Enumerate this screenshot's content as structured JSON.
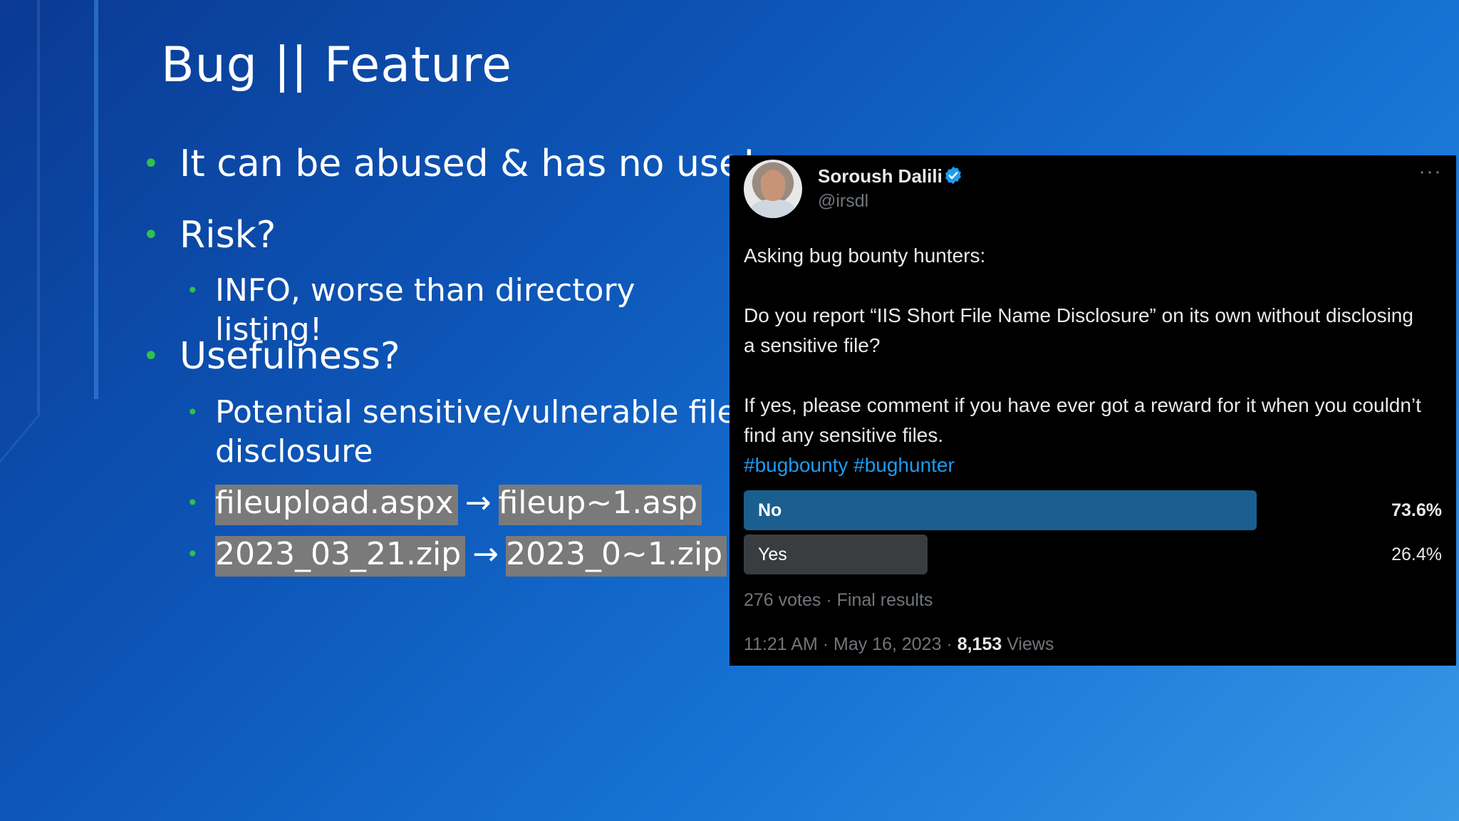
{
  "slide": {
    "title": "Bug || Feature",
    "bullets": [
      {
        "text": "It can be abused & has no use!"
      },
      {
        "text": "Risk?",
        "sub": [
          {
            "text": "INFO, worse than directory listing!"
          }
        ]
      },
      {
        "text": "Usefulness?",
        "sub": [
          {
            "text": "Potential sensitive/vulnerable file disclosure"
          },
          {
            "from": "fileupload.aspx",
            "arrow": "→",
            "to": "fileup~1.asp"
          },
          {
            "from": "2023_03_21.zip",
            "arrow": "→",
            "to": "2023_0~1.zip"
          }
        ]
      }
    ]
  },
  "tweet": {
    "author_name": "Soroush Dalili",
    "handle": "@irsdl",
    "more_label": "···",
    "lines": [
      "Asking bug bounty hunters:",
      "Do you report “IIS Short File Name Disclosure” on its own without disclosing a sensitive file?",
      "If yes, please comment if you have ever got a reward for it when you couldn’t find any sensitive files."
    ],
    "hashtags": "#bugbounty #bughunter",
    "poll": [
      {
        "label": "No",
        "percent": "73.6%",
        "value": 73.6,
        "winner": true,
        "color": "#1a5f8f"
      },
      {
        "label": "Yes",
        "percent": "26.4%",
        "value": 26.4,
        "winner": false,
        "color": "#3a3d40"
      }
    ],
    "votes_text": "276 votes · Final results",
    "time": "11:21 AM · May 16, 2023 · ",
    "views_count": "8,153",
    "views_label": " Views",
    "verified_color": "#1d9bf0"
  }
}
